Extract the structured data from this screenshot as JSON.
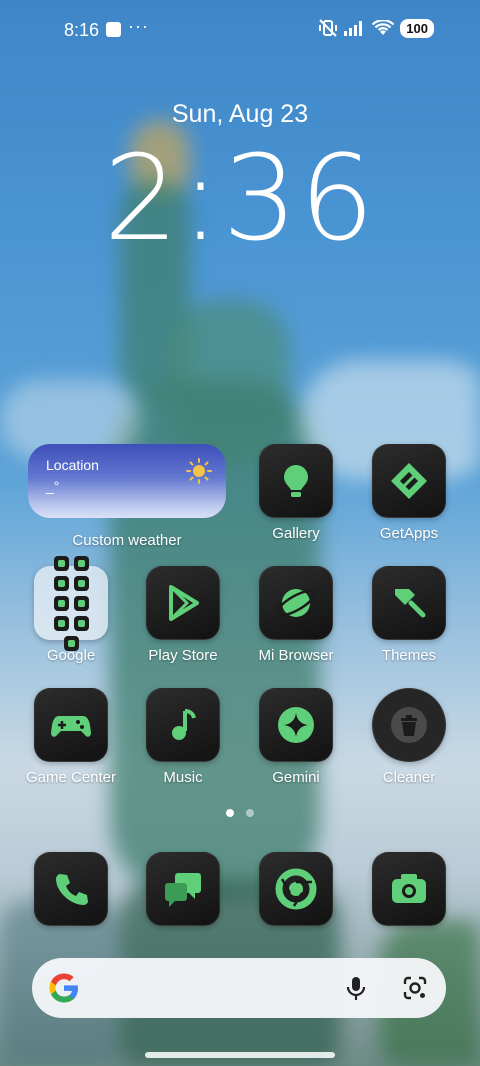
{
  "status_bar": {
    "time": "8:16",
    "dots": "···",
    "battery": "100"
  },
  "clock": {
    "date": "Sun, Aug 23",
    "time": "2:36"
  },
  "weather_widget": {
    "location": "Location",
    "placeholder": "_°",
    "label": "Custom weather"
  },
  "apps": {
    "gallery": "Gallery",
    "getapps": "GetApps",
    "google": "Google",
    "playstore": "Play Store",
    "browser": "Mi Browser",
    "themes": "Themes",
    "gamecenter": "Game Center",
    "music": "Music",
    "gemini": "Gemini",
    "cleaner": "Cleaner"
  },
  "dock": [
    "phone-icon",
    "messages-icon",
    "chrome-icon",
    "camera-icon"
  ],
  "accent_color": "#5fcf7a",
  "page_indicator": {
    "pages": 2,
    "active": 1
  }
}
